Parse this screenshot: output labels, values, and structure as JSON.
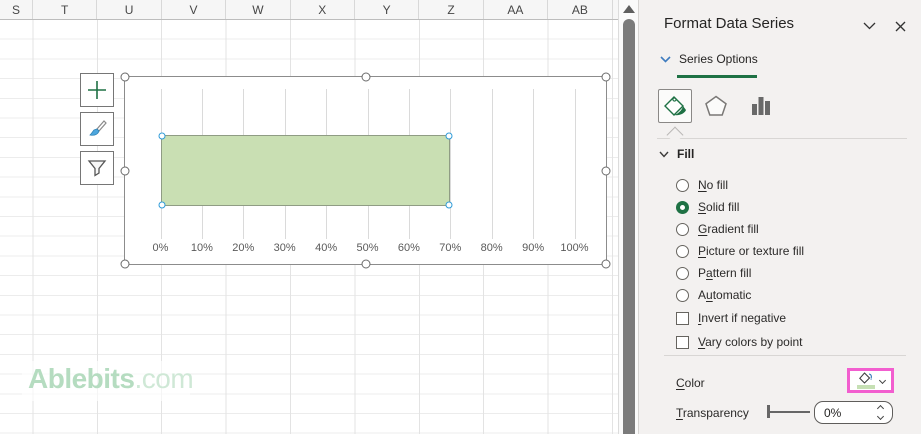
{
  "spreadsheet": {
    "column_headers": [
      "S",
      "T",
      "U",
      "V",
      "W",
      "X",
      "Y",
      "Z",
      "AA",
      "AB"
    ],
    "watermark": {
      "bold": "Ablebits",
      "rest": ".com"
    }
  },
  "chart_buttons": [
    {
      "name": "chart-elements-button",
      "icon": "plus-icon"
    },
    {
      "name": "chart-styles-button",
      "icon": "brush-icon"
    },
    {
      "name": "chart-filters-button",
      "icon": "funnel-icon"
    }
  ],
  "chart_data": {
    "type": "bar",
    "orientation": "horizontal",
    "series": [
      {
        "name": "data-series",
        "values": [
          0.7
        ]
      }
    ],
    "x_ticks": [
      "0%",
      "10%",
      "20%",
      "30%",
      "40%",
      "50%",
      "60%",
      "70%",
      "80%",
      "90%",
      "100%"
    ],
    "xlim": [
      0,
      1
    ],
    "grid": true,
    "bar_fill": "#c9dfb3",
    "legend": "none",
    "title": ""
  },
  "pane": {
    "title": "Format Data Series",
    "header_icons": [
      "chevron-down-icon",
      "close-icon"
    ],
    "section_label": "Series Options",
    "tabs": [
      {
        "name": "fill-and-line",
        "icon": "fill-bucket-icon",
        "selected": true
      },
      {
        "name": "effects",
        "icon": "pentagon-icon",
        "selected": false
      },
      {
        "name": "series-options",
        "icon": "column-chart-icon",
        "selected": false
      }
    ],
    "fill": {
      "header": "Fill",
      "options": [
        {
          "label": "No fill",
          "accel": 0,
          "type": "radio",
          "selected": false
        },
        {
          "label": "Solid fill",
          "accel": 0,
          "type": "radio",
          "selected": true
        },
        {
          "label": "Gradient fill",
          "accel": 0,
          "type": "radio",
          "selected": false
        },
        {
          "label": "Picture or texture fill",
          "accel": 0,
          "type": "radio",
          "selected": false
        },
        {
          "label": "Pattern fill",
          "accel": 1,
          "type": "radio",
          "selected": false
        },
        {
          "label": "Automatic",
          "accel": 1,
          "type": "radio",
          "selected": false
        },
        {
          "label": "Invert if negative",
          "accel": 0,
          "type": "checkbox",
          "checked": false
        },
        {
          "label": "Vary colors by point",
          "accel": 0,
          "type": "checkbox",
          "checked": false
        }
      ],
      "color_label": "Color",
      "color_accel": 0,
      "transparency_label": "Transparency",
      "transparency_accel": 0,
      "transparency_value": "0%"
    },
    "highlight_color": "#f25ecf",
    "accent_green": "#1e7144"
  }
}
